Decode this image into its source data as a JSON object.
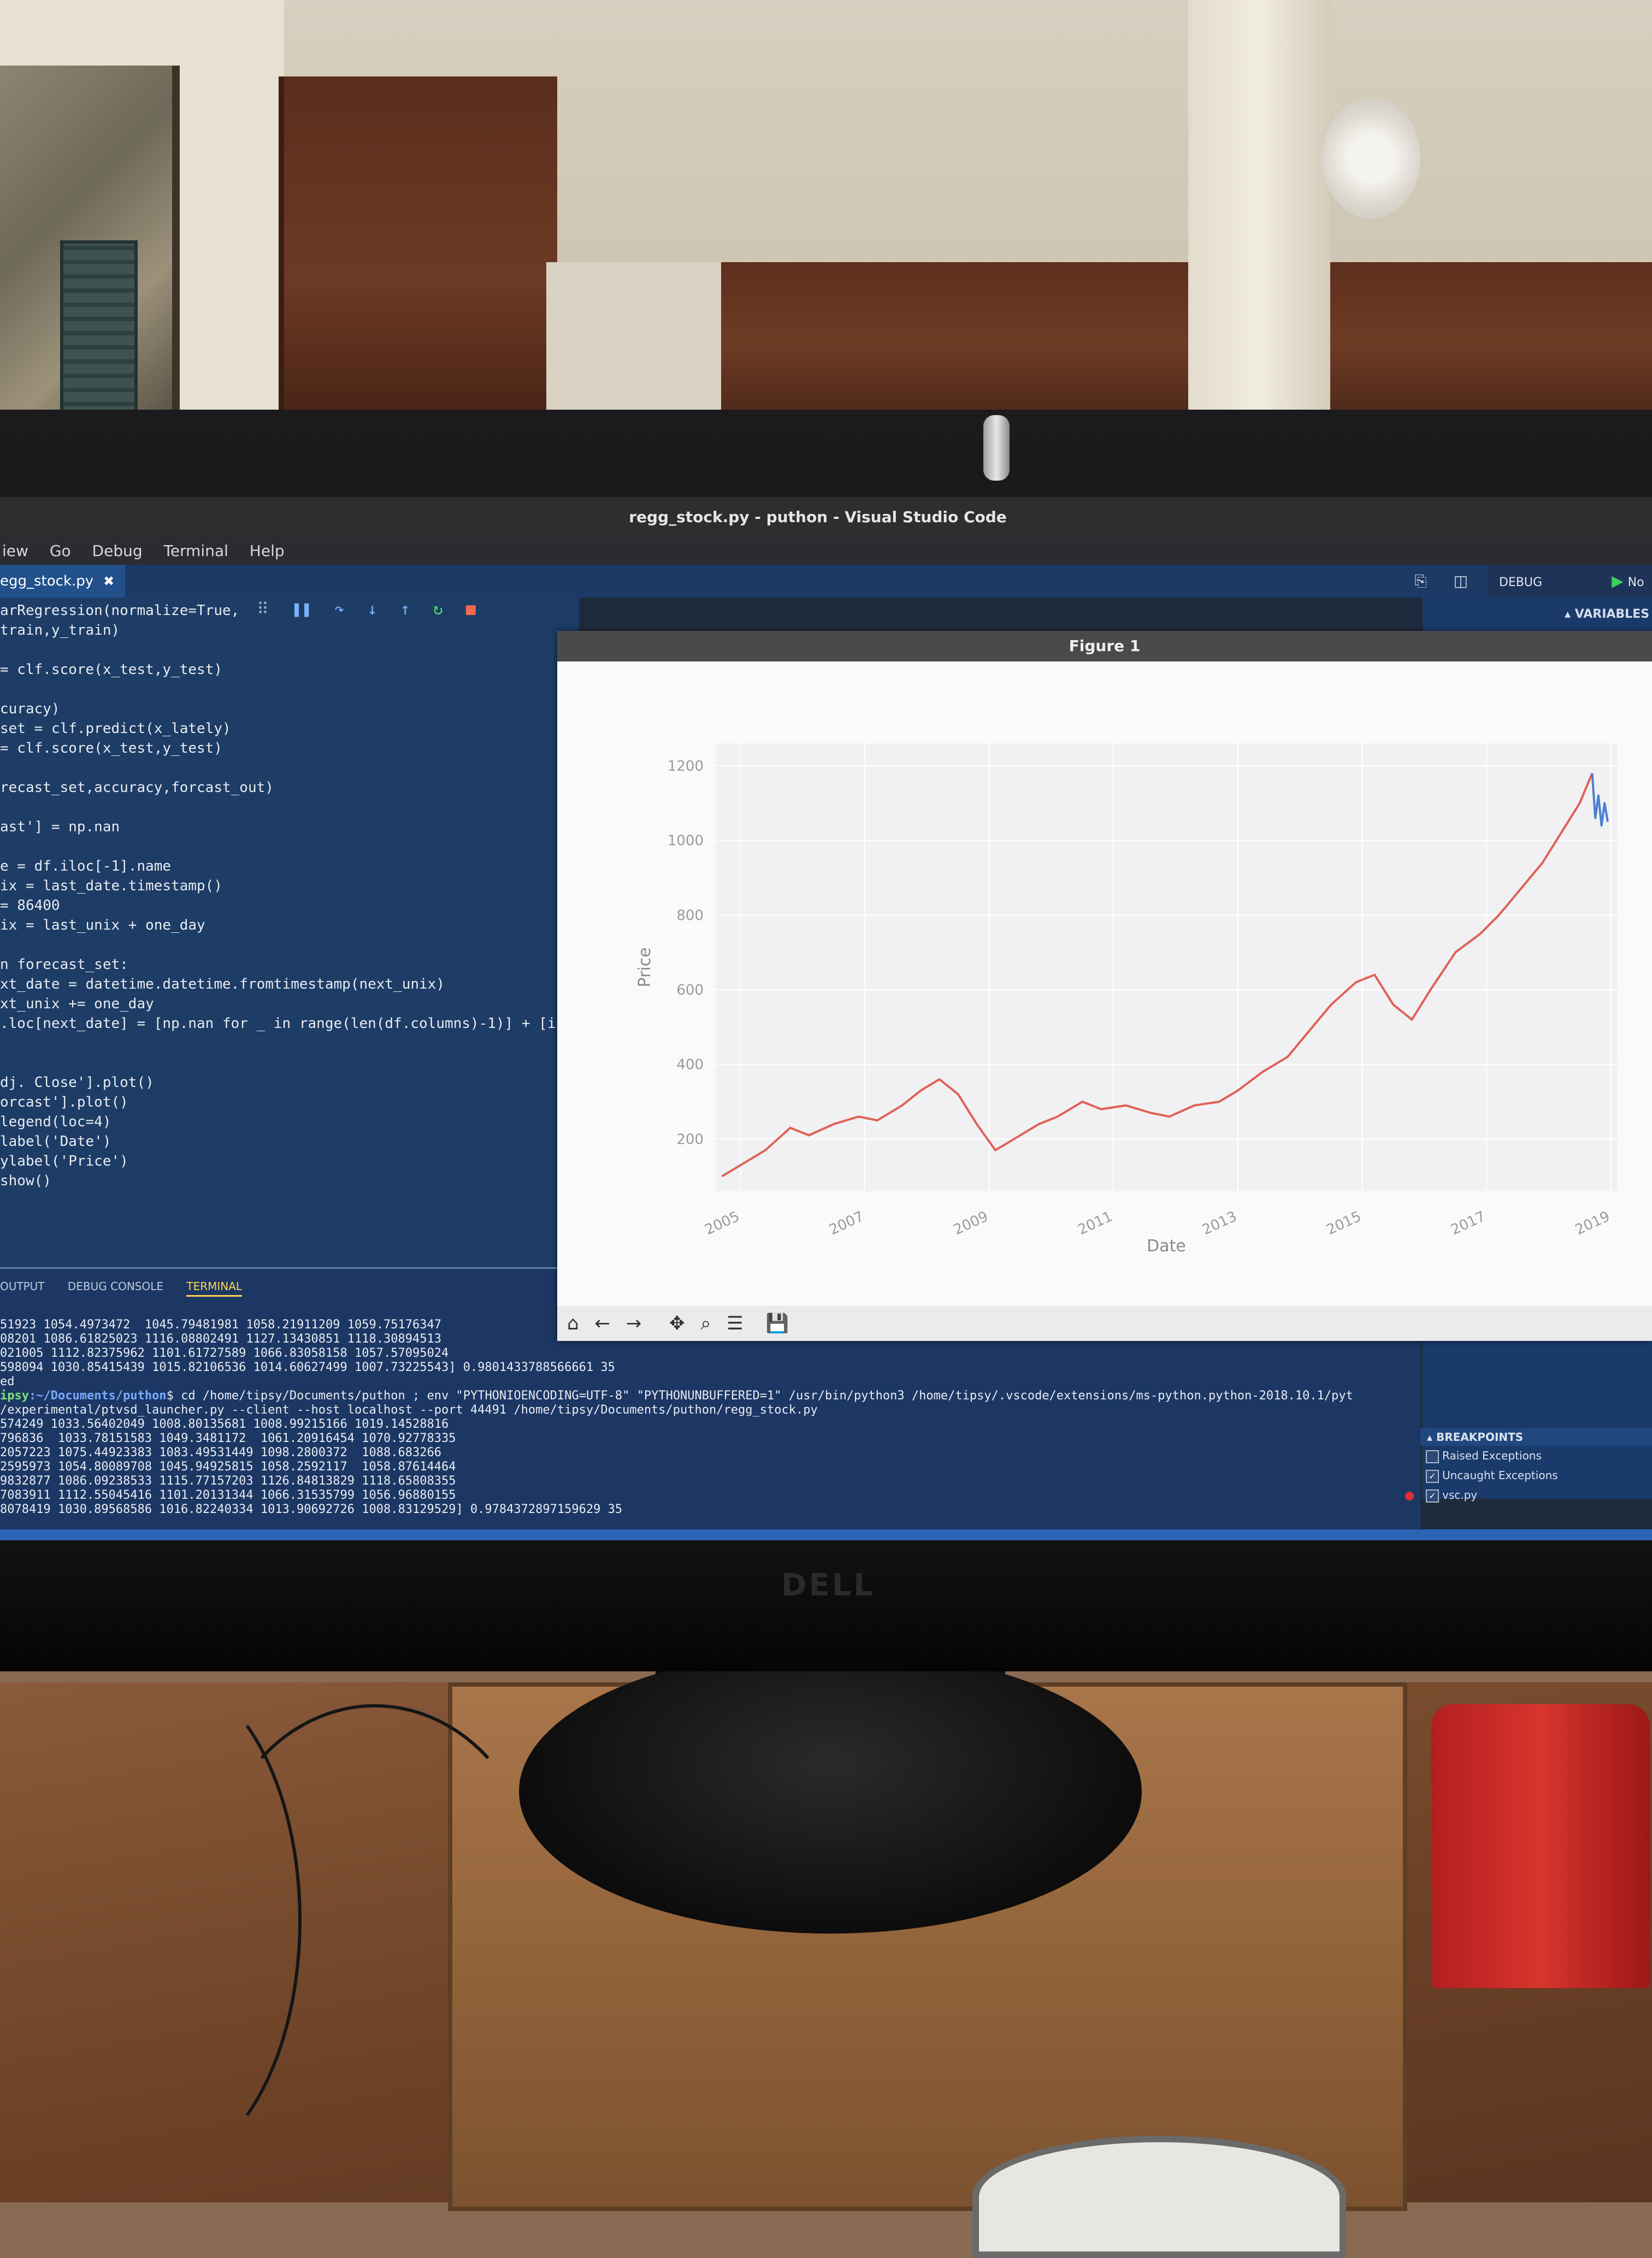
{
  "window": {
    "title": "regg_stock.py - puthon - Visual Studio Code"
  },
  "menu": [
    "iew",
    "Go",
    "Debug",
    "Terminal",
    "Help"
  ],
  "tab": {
    "label": "egg_stock.py",
    "close": "✖"
  },
  "debug_header": {
    "label": "DEBUG",
    "config": "No Configu"
  },
  "variables_label": "VARIABLES",
  "code_lines": [
    "arRegression(normalize=True,",
    "train,y_train)",
    "",
    "= clf.score(x_test,y_test)",
    "",
    "curacy)",
    "set = clf.predict(x_lately)",
    "= clf.score(x_test,y_test)",
    "",
    "recast_set,accuracy,forcast_out)",
    "",
    "ast'] = np.nan",
    "",
    "e = df.iloc[-1].name",
    "ix = last_date.timestamp()",
    "= 86400",
    "ix = last_unix + one_day",
    "",
    "n forecast_set:",
    "xt_date = datetime.datetime.fromtimestamp(next_unix)",
    "xt_unix += one_day",
    ".loc[next_date] = [np.nan for _ in range(len(df.columns)-1)] + [i]",
    "",
    "",
    "dj. Close'].plot()",
    "orcast'].plot()",
    "legend(loc=4)",
    "label('Date')",
    "ylabel('Price')",
    "show()"
  ],
  "panel_tabs": [
    "OUTPUT",
    "DEBUG CONSOLE",
    "TERMINAL"
  ],
  "terminal_lines": [
    "51923 1054.4973472  1045.79481981 1058.21911209 1059.75176347",
    "08201 1086.61825023 1116.08802491 1127.13430851 1118.30894513",
    "021005 1112.82375962 1101.61727589 1066.83058158 1057.57095024",
    "598094 1030.85415439 1015.82106536 1014.60627499 1007.73225543] 0.9801433788566661 35",
    "ed",
    "/experimental/ptvsd_launcher.py --client --host localhost --port 44491 /home/tipsy/Documents/puthon/regg_stock.py",
    "574249 1033.56402049 1008.80135681 1008.99215166 1019.14528816",
    "796836  1033.78151583 1049.3481172  1061.20916454 1070.92778335",
    "2057223 1075.44923383 1083.49531449 1098.2800372  1088.683266",
    "2595973 1054.80089708 1045.94925815 1058.2592117  1058.87614464",
    "9832877 1086.09238533 1115.77157203 1126.84813829 1118.65808355",
    "7083911 1112.55045416 1101.20131344 1066.31535799 1056.96880155",
    "8078419 1030.89568586 1016.82240334 1013.90692726 1008.83129529] 0.9784372897159629 35"
  ],
  "terminal_prompt": {
    "user": "ipsy",
    "path": ":~/Documents/puthon",
    "cmd": "$ cd /home/tipsy/Documents/puthon ; env \"PYTHONIOENCODING=UTF-8\" \"PYTHONUNBUFFERED=1\" /usr/bin/python3 /home/tipsy/.vscode/extensions/ms-python.python-2018.10.1/pyt"
  },
  "breakpoints": {
    "title": "BREAKPOINTS",
    "items": [
      {
        "label": "Raised Exceptions",
        "checked": false
      },
      {
        "label": "Uncaught Exceptions",
        "checked": true
      },
      {
        "label": "vsc.py",
        "checked": true
      }
    ]
  },
  "monitor_brand": "DELL",
  "figure": {
    "title": "Figure 1"
  },
  "chart_data": {
    "type": "line",
    "title": "",
    "xlabel": "Date",
    "ylabel": "Price",
    "xlim": [
      2004.6,
      2019.1
    ],
    "ylim": [
      60,
      1260
    ],
    "x_ticks": [
      "2005",
      "2007",
      "2009",
      "2011",
      "2013",
      "2015",
      "2017",
      "2019"
    ],
    "y_ticks": [
      200,
      400,
      600,
      800,
      1000,
      1200
    ],
    "grid": true,
    "colors": {
      "Adj. Close": "#e06055",
      "Forecast": "#4a7fd0"
    },
    "series": [
      {
        "name": "",
        "color": "#e06055",
        "x": [
          2004.7,
          2005.0,
          2005.4,
          2005.8,
          2006.1,
          2006.5,
          2006.9,
          2007.2,
          2007.6,
          2007.9,
          2008.2,
          2008.5,
          2008.8,
          2009.1,
          2009.4,
          2009.8,
          2010.1,
          2010.5,
          2010.8,
          2011.2,
          2011.6,
          2011.9,
          2012.3,
          2012.7,
          2013.0,
          2013.4,
          2013.8,
          2014.1,
          2014.5,
          2014.9,
          2015.2,
          2015.5,
          2015.8,
          2016.1,
          2016.5,
          2016.9,
          2017.2,
          2017.6,
          2017.9,
          2018.2,
          2018.5,
          2018.7
        ],
        "y": [
          100,
          130,
          170,
          230,
          210,
          240,
          260,
          250,
          290,
          330,
          360,
          320,
          240,
          170,
          200,
          240,
          260,
          300,
          280,
          290,
          270,
          260,
          290,
          300,
          330,
          380,
          420,
          480,
          560,
          620,
          640,
          560,
          520,
          600,
          700,
          750,
          800,
          880,
          940,
          1020,
          1100,
          1180
        ]
      },
      {
        "name": "",
        "color": "#4a7fd0",
        "x": [
          2018.7,
          2018.75,
          2018.8,
          2018.85,
          2018.9,
          2018.95
        ],
        "y": [
          1180,
          1060,
          1120,
          1040,
          1100,
          1050
        ]
      }
    ]
  },
  "figure_toolbar": [
    "home-icon",
    "back-icon",
    "forward-icon",
    "pan-icon",
    "zoom-icon",
    "configure-icon",
    "save-icon"
  ]
}
